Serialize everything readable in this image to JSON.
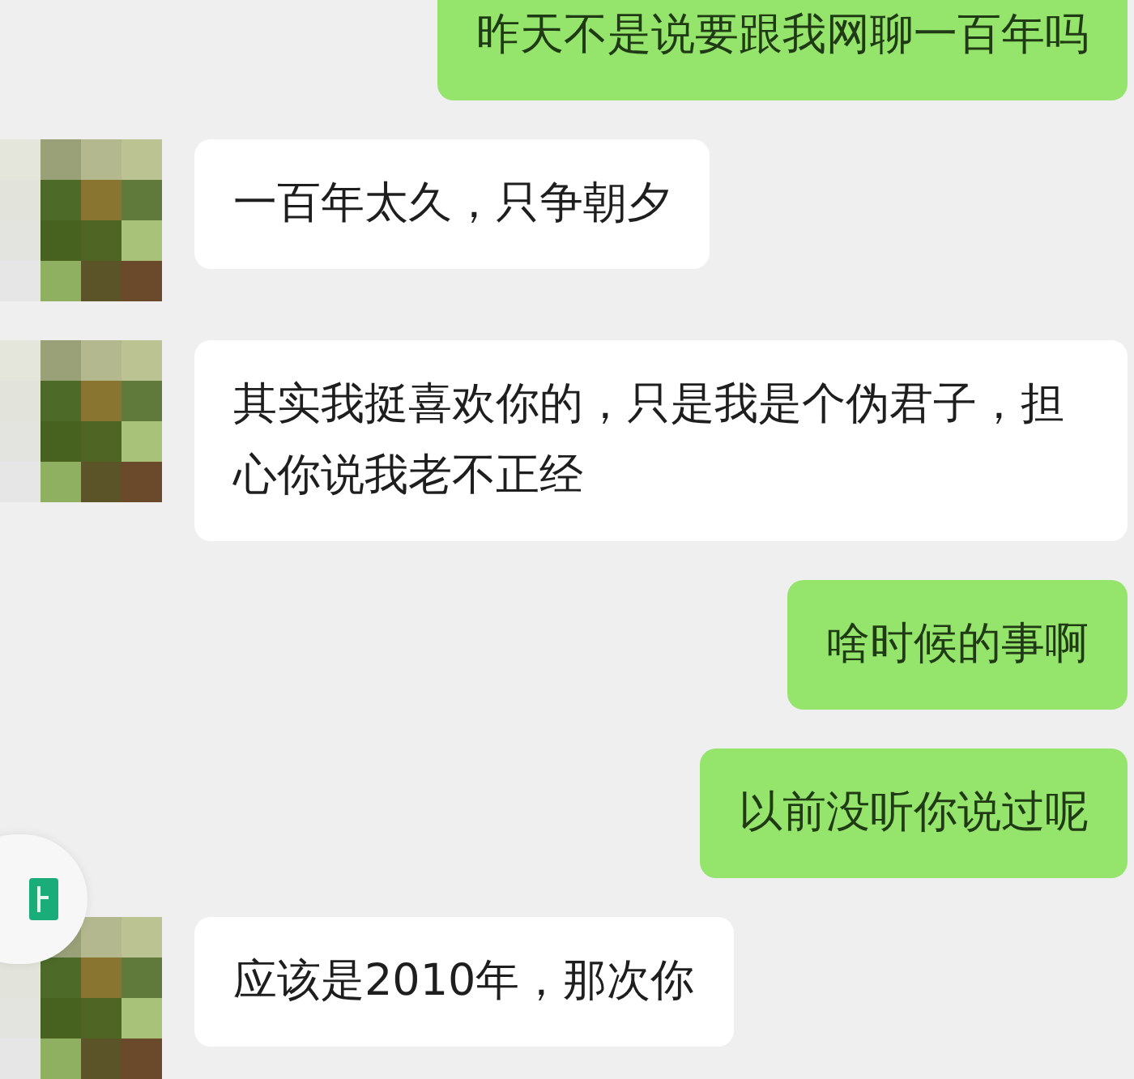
{
  "messages": [
    {
      "kind": "me",
      "text": "昨天不是说要跟我网聊一百年吗"
    },
    {
      "kind": "other",
      "text": "一百年太久，只争朝夕"
    },
    {
      "kind": "other",
      "text": "其实我挺喜欢你的，只是我是个伪君子，担心你说我老不正经"
    },
    {
      "kind": "me",
      "text": "啥时候的事啊"
    },
    {
      "kind": "me",
      "text": "以前没听你说过呢"
    },
    {
      "kind": "other",
      "text": "应该是2010年，那次你"
    }
  ]
}
